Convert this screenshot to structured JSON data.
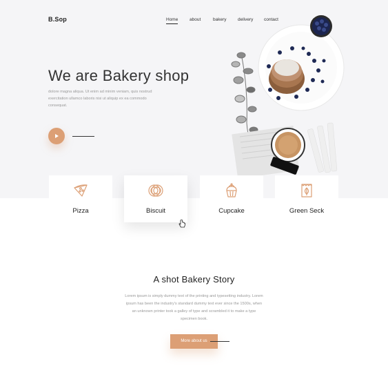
{
  "brand": {
    "logo": "B.Sop"
  },
  "nav": {
    "items": [
      {
        "label": "Home",
        "active": true
      },
      {
        "label": "about",
        "active": false
      },
      {
        "label": "bakery",
        "active": false
      },
      {
        "label": "delivery",
        "active": false
      },
      {
        "label": "contact",
        "active": false
      }
    ]
  },
  "hero": {
    "title": "We are Bakery shop",
    "text": "dolore magna aliqua. Ut enim ad minim veniam, quis nostrud exercitation ullamco laboris nisi ut aliquip ex ea commodo consequat."
  },
  "categories": [
    {
      "label": "Pizza",
      "icon": "pizza-slice-icon"
    },
    {
      "label": "Biscuit",
      "icon": "biscuit-icon"
    },
    {
      "label": "Cupcake",
      "icon": "cupcake-icon"
    },
    {
      "label": "Green Seck",
      "icon": "green-sack-icon"
    }
  ],
  "story": {
    "title": "A shot Bakery Story",
    "text": "Lorem ipsum is simply dummy text of the printing and typesetting industry. Lorem ipsum has been the industry's standard dummy text ever since the 1500s, when an unknown printer took a galley of type and scrambled it to make a type specimen book.",
    "button_label": "More about us"
  },
  "colors": {
    "accent": "#dc9f75",
    "hero_background": "#f5f5f7",
    "text_dark": "#222222",
    "text_muted": "#999999"
  }
}
